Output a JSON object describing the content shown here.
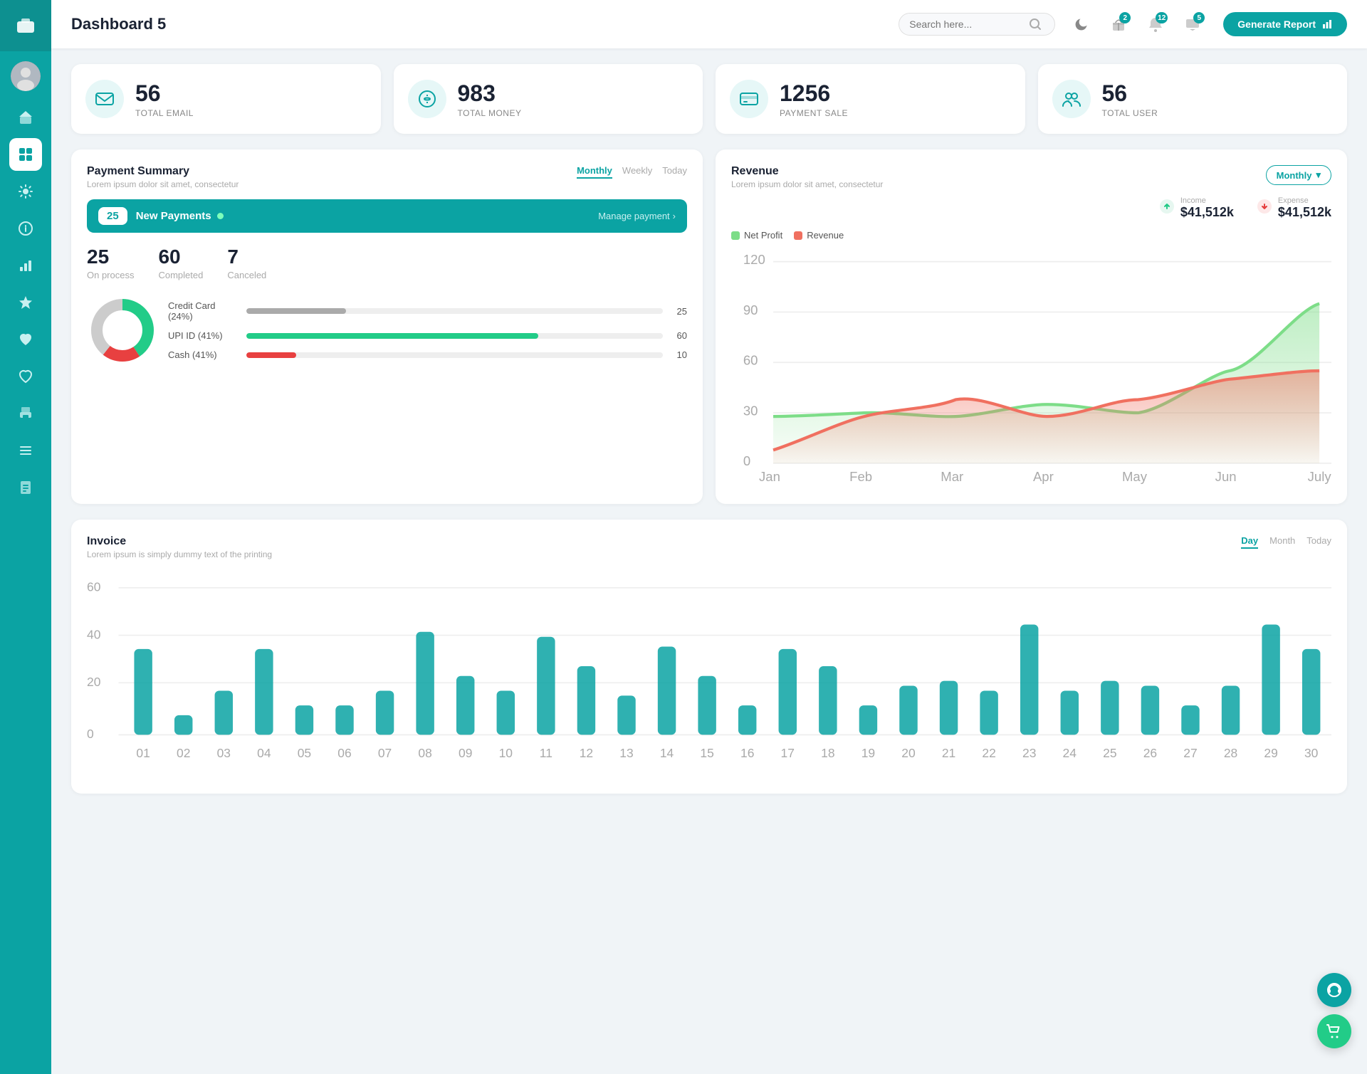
{
  "sidebar": {
    "logo_icon": "💼",
    "nav_items": [
      {
        "id": "home",
        "icon": "🏠",
        "active": false
      },
      {
        "id": "dashboard",
        "icon": "⊞",
        "active": true
      },
      {
        "id": "settings",
        "icon": "⚙",
        "active": false
      },
      {
        "id": "info",
        "icon": "ℹ",
        "active": false
      },
      {
        "id": "chart",
        "icon": "📊",
        "active": false
      },
      {
        "id": "star",
        "icon": "★",
        "active": false
      },
      {
        "id": "heart",
        "icon": "♥",
        "active": false
      },
      {
        "id": "heart2",
        "icon": "❤",
        "active": false
      },
      {
        "id": "print",
        "icon": "🖨",
        "active": false
      },
      {
        "id": "list",
        "icon": "☰",
        "active": false
      },
      {
        "id": "docs",
        "icon": "📋",
        "active": false
      }
    ]
  },
  "header": {
    "title": "Dashboard 5",
    "search_placeholder": "Search here...",
    "generate_btn": "Generate Report",
    "icons": {
      "moon": "🌙",
      "gift_badge": "2",
      "bell_badge": "12",
      "chat_badge": "5"
    }
  },
  "stat_cards": [
    {
      "id": "email",
      "num": "56",
      "label": "TOTAL EMAIL",
      "icon": "📋"
    },
    {
      "id": "money",
      "num": "983",
      "label": "TOTAL MONEY",
      "icon": "$"
    },
    {
      "id": "payment",
      "num": "1256",
      "label": "PAYMENT SALE",
      "icon": "💳"
    },
    {
      "id": "user",
      "num": "56",
      "label": "TOTAL USER",
      "icon": "👥"
    }
  ],
  "payment_summary": {
    "title": "Payment Summary",
    "subtitle": "Lorem ipsum dolor sit amet, consectetur",
    "tabs": [
      "Monthly",
      "Weekly",
      "Today"
    ],
    "active_tab": "Monthly",
    "new_payments_count": "25",
    "new_payments_label": "New Payments",
    "manage_link": "Manage payment",
    "stats": [
      {
        "num": "25",
        "label": "On process"
      },
      {
        "num": "60",
        "label": "Completed"
      },
      {
        "num": "7",
        "label": "Canceled"
      }
    ],
    "methods": [
      {
        "label": "Credit Card (24%)",
        "pct": 24,
        "color": "#aaa",
        "val": "25"
      },
      {
        "label": "UPI ID (41%)",
        "pct": 70,
        "color": "#22cc88",
        "val": "60"
      },
      {
        "label": "Cash (41%)",
        "pct": 12,
        "color": "#e84040",
        "val": "10"
      }
    ]
  },
  "revenue": {
    "title": "Revenue",
    "subtitle": "Lorem ipsum dolor sit amet, consectetur",
    "monthly_btn": "Monthly",
    "income_label": "Income",
    "income_val": "$41,512k",
    "expense_label": "Expense",
    "expense_val": "$41,512k",
    "legend": [
      {
        "label": "Net Profit",
        "color": "#7ddd88"
      },
      {
        "label": "Revenue",
        "color": "#f07060"
      }
    ],
    "x_labels": [
      "Jan",
      "Feb",
      "Mar",
      "Apr",
      "May",
      "Jun",
      "July"
    ],
    "y_labels": [
      "120",
      "90",
      "60",
      "30",
      "0"
    ],
    "net_profit_data": [
      28,
      30,
      28,
      35,
      30,
      55,
      95,
      90
    ],
    "revenue_data": [
      8,
      28,
      38,
      28,
      38,
      38,
      50,
      52
    ]
  },
  "invoice": {
    "title": "Invoice",
    "subtitle": "Lorem ipsum is simply dummy text of the printing",
    "tabs": [
      "Day",
      "Month",
      "Today"
    ],
    "active_tab": "Day",
    "y_labels": [
      "60",
      "40",
      "20",
      "0"
    ],
    "x_labels": [
      "01",
      "02",
      "03",
      "04",
      "05",
      "06",
      "07",
      "08",
      "09",
      "10",
      "11",
      "12",
      "13",
      "14",
      "15",
      "16",
      "17",
      "18",
      "19",
      "20",
      "21",
      "22",
      "23",
      "24",
      "25",
      "26",
      "27",
      "28",
      "29",
      "30"
    ],
    "bar_data": [
      35,
      8,
      18,
      35,
      12,
      12,
      18,
      42,
      24,
      18,
      40,
      28,
      16,
      36,
      24,
      12,
      35,
      28,
      12,
      20,
      22,
      18,
      45,
      18,
      22,
      20,
      12,
      20,
      45,
      35
    ]
  },
  "fabs": [
    {
      "id": "support",
      "icon": "🎧",
      "color": "#0ba3a3"
    },
    {
      "id": "cart",
      "icon": "🛒",
      "color": "#22cc88"
    }
  ]
}
